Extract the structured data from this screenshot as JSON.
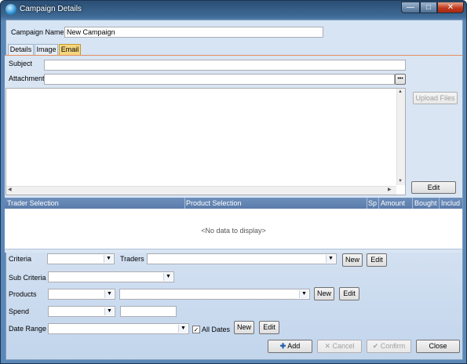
{
  "window": {
    "title": "Campaign Details",
    "minimize": "—",
    "maximize": "□",
    "close": "✕"
  },
  "campaign": {
    "name_label": "Campaign Name",
    "name_value": "New Campaign"
  },
  "tabs": [
    {
      "label": "Details"
    },
    {
      "label": "Image"
    },
    {
      "label": "Email",
      "active": true
    }
  ],
  "email": {
    "subject_label": "Subject",
    "subject_value": "",
    "attachment_label": "Attachment",
    "attachment_value": "",
    "browse_label": "•••",
    "upload_files_label": "Upload Files",
    "edit_label": "Edit"
  },
  "grid": {
    "columns": [
      "Trader Selection",
      "Product Selection",
      "Sp",
      "Amount",
      "Bought",
      "Includ"
    ],
    "empty_text": "<No data to display>"
  },
  "filters": {
    "criteria_label": "Criteria",
    "traders_label": "Traders",
    "sub_criteria_label": "Sub Criteria",
    "products_label": "Products",
    "spend_label": "Spend",
    "date_range_label": "Date Range",
    "all_dates_label": "All Dates",
    "all_dates_checked": true,
    "new_label": "New",
    "edit_label": "Edit"
  },
  "footer": {
    "add_label": "Add",
    "cancel_label": "Cancel",
    "confirm_label": "Confirm",
    "close_label": "Close"
  },
  "icons": {
    "dropdown": "chevron-down-icon",
    "add": "plus-icon",
    "cancel": "x-icon",
    "confirm": "check-icon"
  },
  "colors": {
    "accent_tab": "#f5d67e",
    "grid_header": "#5a7cab",
    "titlebar": "#3e6a95"
  }
}
